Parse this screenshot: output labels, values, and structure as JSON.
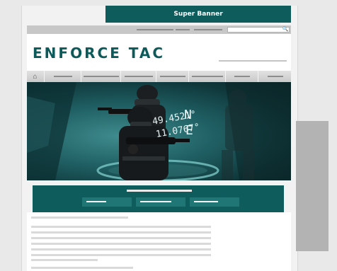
{
  "super_banner": {
    "label": "Super Banner"
  },
  "logo": {
    "text": "ENFORCE TAC"
  },
  "hero": {
    "coordinates": [
      "49.4521°",
      "11.0767°"
    ],
    "compass": [
      "N",
      "E"
    ]
  },
  "icons": {
    "home": "home-icon",
    "search": "search-icon"
  },
  "colors": {
    "brand": "#0e5c5b",
    "background": "#e9e9e9",
    "placeholder": "#b3b3b3"
  }
}
